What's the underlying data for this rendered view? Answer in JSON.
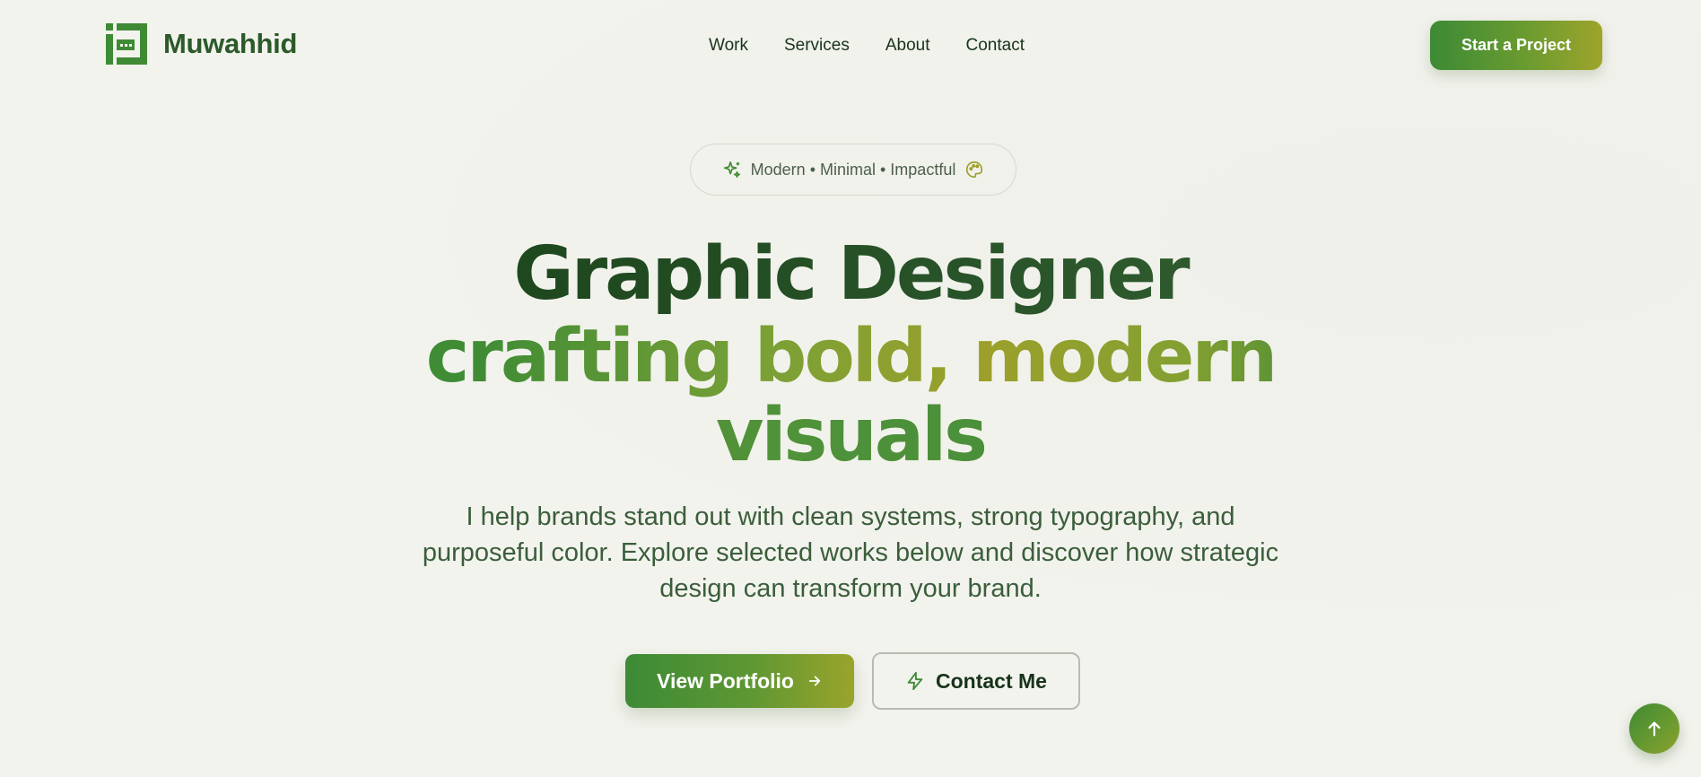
{
  "brand": {
    "name": "Muwahhid",
    "logo_icon": "logo-mark-icon",
    "color": "#3f8a35"
  },
  "nav": {
    "items": [
      {
        "label": "Work"
      },
      {
        "label": "Services"
      },
      {
        "label": "About"
      },
      {
        "label": "Contact"
      }
    ],
    "cta_label": "Start a Project"
  },
  "hero": {
    "tagline": "Modern • Minimal • Impactful",
    "tagline_left_icon": "sparkle-icon",
    "tagline_right_icon": "palette-icon",
    "headline_line1": "Graphic Designer",
    "headline_line2": "crafting bold, modern",
    "headline_line3": "visuals",
    "description": "I help brands stand out with clean systems, strong typography, and purposeful color. Explore selected works below and discover how strategic design can transform your brand.",
    "primary_button": "View Portfolio",
    "primary_button_icon": "arrow-right-icon",
    "secondary_button": "Contact Me",
    "secondary_button_icon": "lightning-icon"
  },
  "scroll_top_icon": "arrow-up-icon",
  "colors": {
    "background": "#f3f3ee",
    "primary_green": "#3d8a35",
    "olive_accent": "#9ea42b",
    "dark_green": "#123e12"
  }
}
